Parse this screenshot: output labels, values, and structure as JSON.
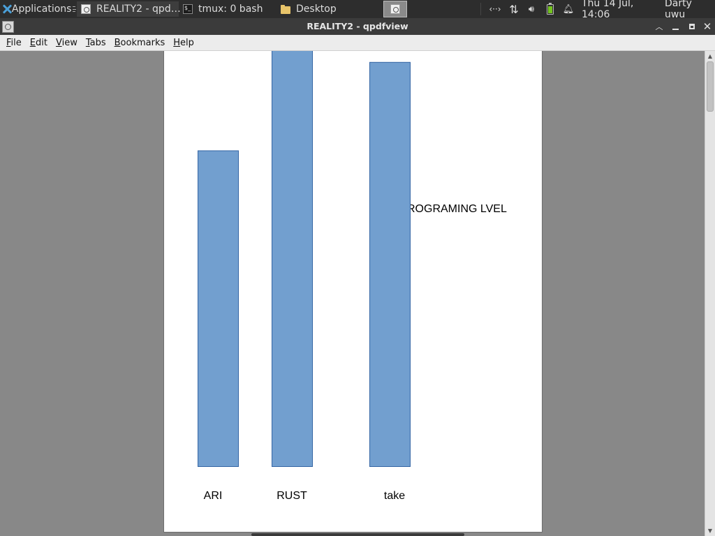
{
  "taskbar": {
    "apps_label": "Applications",
    "tasks": [
      {
        "label": "REALITY2 - qpd…",
        "icon": "pdf-document-icon",
        "active": true
      },
      {
        "label": "tmux: 0 bash",
        "icon": "terminal-icon",
        "active": false
      },
      {
        "label": "Desktop",
        "icon": "folder-icon",
        "active": false
      }
    ],
    "tray": {
      "network_glyph": "‹··›",
      "updown_glyph": "⇅",
      "volume_glyph": "🔊︎",
      "bell_glyph": "🔔︎"
    },
    "clock": "Thu 14 Jul, 14:06",
    "user": "Darty uwu"
  },
  "window": {
    "title": "REALITY2 - qpdfview",
    "buttons": {
      "shade": "︿",
      "close": "✕"
    }
  },
  "menubar": {
    "items": [
      {
        "mnemonic": "F",
        "rest": "ile"
      },
      {
        "mnemonic": "E",
        "rest": "dit"
      },
      {
        "mnemonic": "V",
        "rest": "iew"
      },
      {
        "mnemonic": "T",
        "rest": "abs"
      },
      {
        "mnemonic": "B",
        "rest": "ookmarks"
      },
      {
        "mnemonic": "H",
        "rest": "elp"
      }
    ]
  },
  "scrollbar": {
    "up_glyph": "▲",
    "down_glyph": "▼"
  },
  "chart_data": {
    "type": "bar",
    "title": "ROGRAMING LVEL",
    "categories": [
      "ARI",
      "RUST",
      "take"
    ],
    "values": [
      50,
      70,
      64
    ],
    "note_values": "relative bar heights; the chart has no value axis or gridlines (top of RUST bar is cut off by the viewport)",
    "bar_color": "#729fcf",
    "bar_border": "#3465a4",
    "xlabel": "",
    "ylabel": "",
    "grid": false
  },
  "colors": {
    "taskbar_bg": "#2d2d2d",
    "titlebar_bg": "#3b3b3b",
    "menubar_bg": "#ececec",
    "viewport_bg": "#888888",
    "page_bg": "#ffffff"
  }
}
